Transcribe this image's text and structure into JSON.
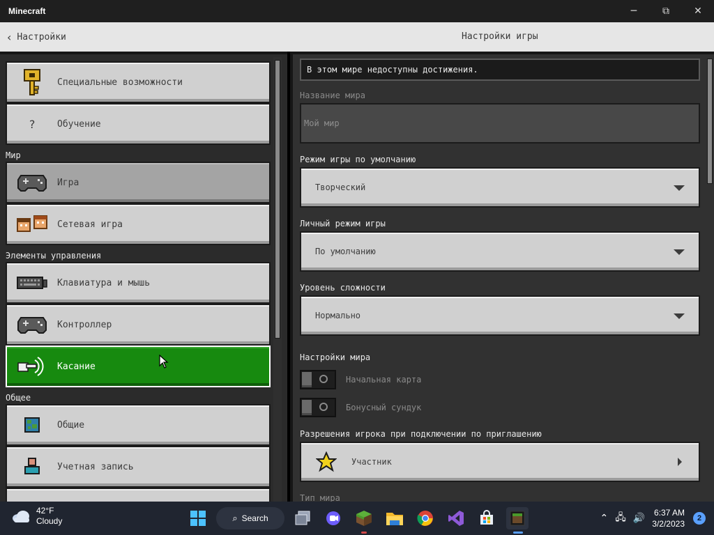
{
  "window": {
    "title": "Minecraft",
    "minimize": "─",
    "maximize": "⧉",
    "close": "✕"
  },
  "header": {
    "back_label": "Настройки",
    "page_title": "Настройки игры"
  },
  "sidebar": {
    "items_top": [
      {
        "label": "Специальные возможности",
        "icon": "key-icon"
      },
      {
        "label": "Обучение",
        "icon": "question-icon",
        "glyph": "?"
      }
    ],
    "section_world": "Мир",
    "items_world": [
      {
        "label": "Игра",
        "icon": "controller-icon",
        "selected": true
      },
      {
        "label": "Сетевая игра",
        "icon": "multiplayer-icon"
      }
    ],
    "section_controls": "Элементы управления",
    "items_controls": [
      {
        "label": "Клавиатура и мышь",
        "icon": "keyboard-icon"
      },
      {
        "label": "Контроллер",
        "icon": "controller-icon"
      },
      {
        "label": "Касание",
        "icon": "touch-icon",
        "active": true
      }
    ],
    "section_general": "Общее",
    "items_general": [
      {
        "label": "Общие",
        "icon": "globe-icon"
      },
      {
        "label": "Учетная запись",
        "icon": "account-icon"
      }
    ]
  },
  "settings": {
    "notice": "В этом мире недоступны достижения.",
    "world_name_label": "Название мира",
    "world_name_value": "Мой мир",
    "default_mode_label": "Режим игры по умолчанию",
    "default_mode_value": "Творческий",
    "personal_mode_label": "Личный режим игры",
    "personal_mode_value": "По умолчанию",
    "difficulty_label": "Уровень сложности",
    "difficulty_value": "Нормально",
    "world_settings_label": "Настройки мира",
    "starting_map_label": "Начальная карта",
    "starting_map_on": false,
    "bonus_chest_label": "Бонусный сундук",
    "bonus_chest_on": false,
    "permissions_label": "Разрешения игрока при подключении по приглашению",
    "permissions_value": "Участник",
    "world_type_label": "Тип мира"
  },
  "colors": {
    "active_green": "#178a0f",
    "button_gray": "#d0d0d0",
    "panel_dark": "#313131"
  },
  "taskbar": {
    "weather_temp": "42°F",
    "weather_desc": "Cloudy",
    "search_label": "Search",
    "time": "6:37 AM",
    "date": "3/2/2023",
    "notifications": "2"
  }
}
